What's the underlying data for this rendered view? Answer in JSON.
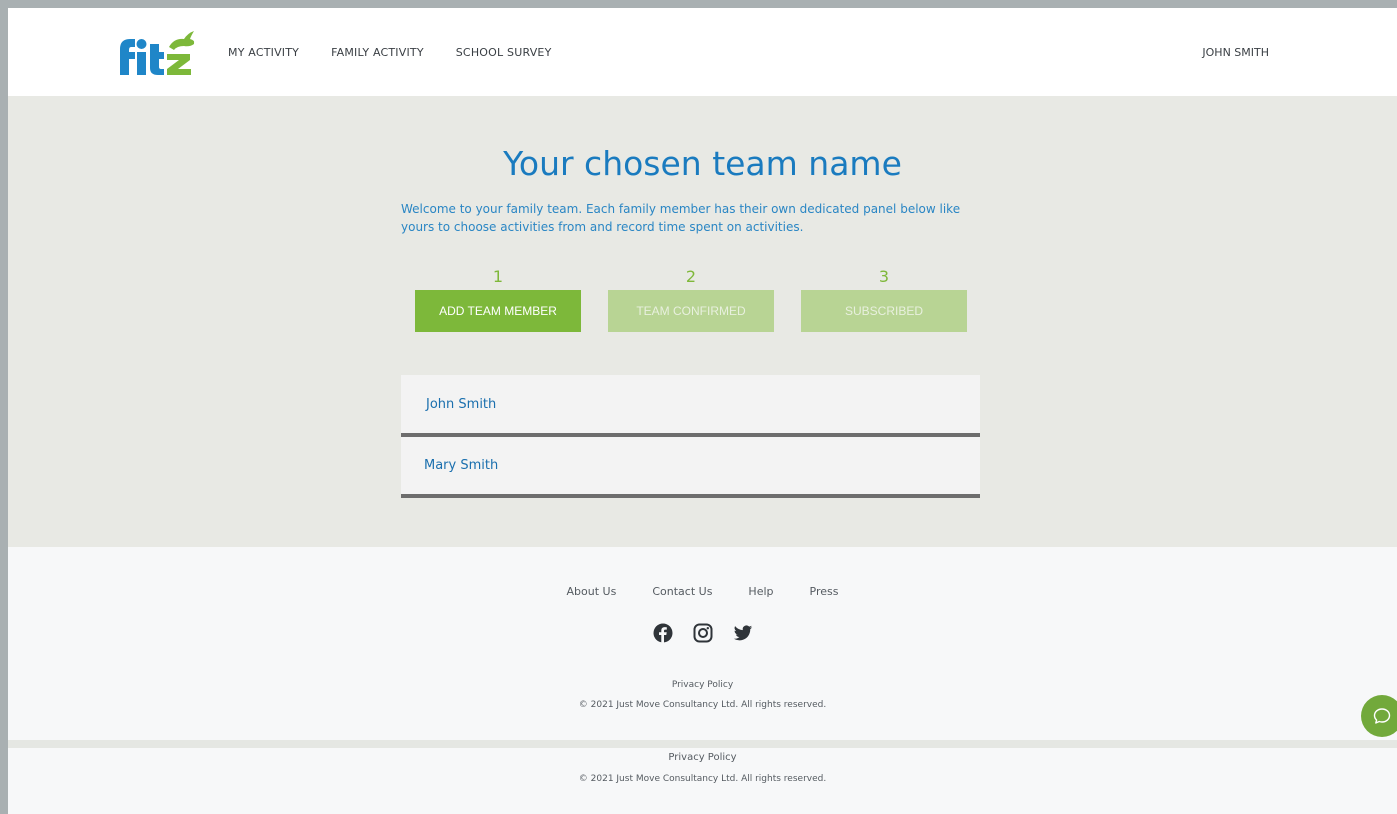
{
  "brand": {
    "logo_text": "fitz",
    "logo_blue": "#1f86c8",
    "logo_green": "#7db83a"
  },
  "nav": {
    "items": [
      {
        "label": "MY ACTIVITY"
      },
      {
        "label": "FAMILY ACTIVITY"
      },
      {
        "label": "SCHOOL SURVEY"
      }
    ],
    "user": "JOHN SMITH"
  },
  "main": {
    "title": "Your chosen team name",
    "intro": "Welcome to your family team. Each family member has their own dedicated panel below like yours to choose activities from and record time spent on activities.",
    "steps": [
      {
        "number": "1",
        "label": "ADD TEAM MEMBER",
        "state": "active"
      },
      {
        "number": "2",
        "label": "TEAM CONFIRMED",
        "state": "inactive"
      },
      {
        "number": "3",
        "label": "SUBSCRIBED",
        "state": "inactive"
      }
    ],
    "members": [
      {
        "name": "John Smith"
      },
      {
        "name": "Mary Smith"
      }
    ]
  },
  "footer": {
    "links": [
      {
        "label": "About Us"
      },
      {
        "label": "Contact Us"
      },
      {
        "label": "Help"
      },
      {
        "label": "Press"
      }
    ],
    "social": [
      "facebook-icon",
      "instagram-icon",
      "twitter-icon"
    ],
    "privacy": "Privacy Policy",
    "copyright": "© 2021 Just Move Consultancy Ltd. All rights reserved."
  },
  "footer_bottom": {
    "privacy": "Privacy Policy",
    "copyright": "© 2021 Just Move Consultancy Ltd. All rights reserved."
  },
  "colors": {
    "accent_blue": "#1a7bbf",
    "step_active": "#7db83a",
    "step_inactive": "#b8d494",
    "main_bg": "#e8e9e4"
  },
  "chat": {
    "icon": "chat-bubble-icon"
  }
}
